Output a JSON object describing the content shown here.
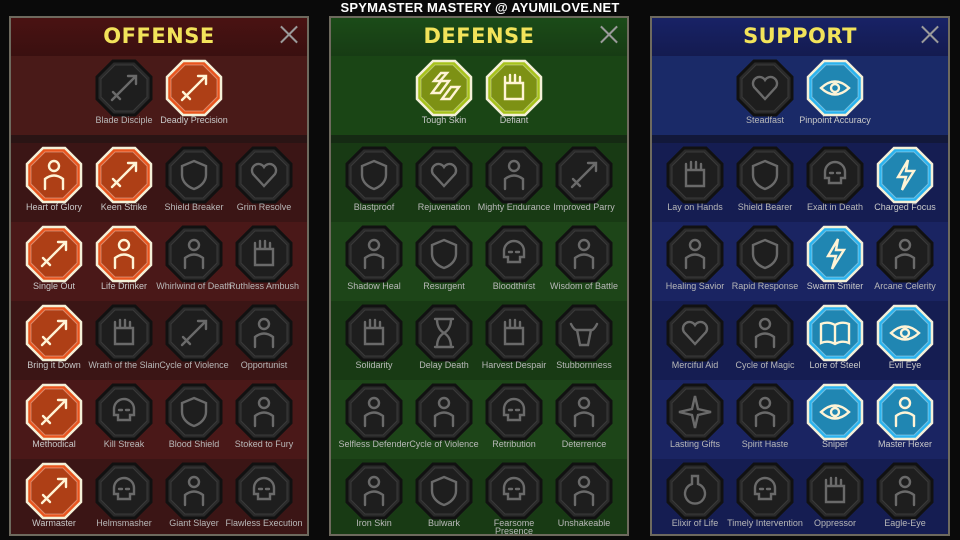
{
  "banner": "SPYMASTER MASTERY @ AYUMILOVE.NET",
  "colors": {
    "offense_active": "#e8551e",
    "defense_active": "#a7c21b",
    "support_active": "#2bb3ee",
    "inactive": "#2a2a2a",
    "title": "#f2e35a"
  },
  "panels": [
    {
      "key": "offense",
      "title": "OFFENSE",
      "rows": [
        [
          {
            "name": "Blade Disciple",
            "active": false,
            "icon": "crossed-blades-icon"
          },
          {
            "name": "Deadly Precision",
            "active": true,
            "icon": "dagger-strike-icon"
          }
        ],
        [
          {
            "name": "Heart of Glory",
            "active": true,
            "icon": "horned-warrior-icon"
          },
          {
            "name": "Keen Strike",
            "active": true,
            "icon": "slash-icon"
          },
          {
            "name": "Shield Breaker",
            "active": false,
            "icon": "broken-shield-icon"
          },
          {
            "name": "Grim Resolve",
            "active": false,
            "icon": "heart-spikes-icon"
          }
        ],
        [
          {
            "name": "Single Out",
            "active": true,
            "icon": "arrows-target-icon"
          },
          {
            "name": "Life Drinker",
            "active": true,
            "icon": "fangs-icon"
          },
          {
            "name": "Whirlwind of Death",
            "active": false,
            "icon": "whirlwind-icon"
          },
          {
            "name": "Ruthless Ambush",
            "active": false,
            "icon": "dagger-hand-icon"
          }
        ],
        [
          {
            "name": "Bring it Down",
            "active": true,
            "icon": "sword-down-icon"
          },
          {
            "name": "Wrath of the Slain",
            "active": false,
            "icon": "fist-icon"
          },
          {
            "name": "Cycle of Violence",
            "active": false,
            "icon": "axe-icon"
          },
          {
            "name": "Opportunist",
            "active": false,
            "icon": "chains-icon"
          }
        ],
        [
          {
            "name": "Methodical",
            "active": true,
            "icon": "arrows-burst-icon"
          },
          {
            "name": "Kill Streak",
            "active": false,
            "icon": "skull-icon"
          },
          {
            "name": "Blood Shield",
            "active": false,
            "icon": "shield-icon"
          },
          {
            "name": "Stoked to Fury",
            "active": false,
            "icon": "raging-figure-icon"
          }
        ],
        [
          {
            "name": "Warmaster",
            "active": true,
            "icon": "sword-sparks-icon"
          },
          {
            "name": "Helmsmasher",
            "active": false,
            "icon": "helmet-icon"
          },
          {
            "name": "Giant Slayer",
            "active": false,
            "icon": "giant-icon"
          },
          {
            "name": "Flawless Execution",
            "active": false,
            "icon": "skull-execution-icon"
          }
        ]
      ]
    },
    {
      "key": "defense",
      "title": "DEFENSE",
      "rows": [
        [
          {
            "name": "Tough Skin",
            "active": true,
            "icon": "scales-icon"
          },
          {
            "name": "Defiant",
            "active": true,
            "icon": "raised-fist-icon"
          }
        ],
        [
          {
            "name": "Blastproof",
            "active": false,
            "icon": "chevron-shield-icon"
          },
          {
            "name": "Rejuvenation",
            "active": false,
            "icon": "heart-hand-icon"
          },
          {
            "name": "Mighty Endurance",
            "active": false,
            "icon": "strongman-icon"
          },
          {
            "name": "Improved Parry",
            "active": false,
            "icon": "parry-blades-icon"
          }
        ],
        [
          {
            "name": "Shadow Heal",
            "active": false,
            "icon": "shadow-figure-icon"
          },
          {
            "name": "Resurgent",
            "active": false,
            "icon": "knight-shield-icon"
          },
          {
            "name": "Bloodthirst",
            "active": false,
            "icon": "skull-heart-icon"
          },
          {
            "name": "Wisdom of Battle",
            "active": false,
            "icon": "sage-icon"
          }
        ],
        [
          {
            "name": "Solidarity",
            "active": false,
            "icon": "raised-hands-icon"
          },
          {
            "name": "Delay Death",
            "active": false,
            "icon": "hourglass-icon"
          },
          {
            "name": "Harvest Despair",
            "active": false,
            "icon": "open-hand-icon"
          },
          {
            "name": "Stubbornness",
            "active": false,
            "icon": "bull-icon"
          }
        ],
        [
          {
            "name": "Selfless Defender",
            "active": false,
            "icon": "defender-icon"
          },
          {
            "name": "Cycle of Violence",
            "active": false,
            "icon": "drops-icon"
          },
          {
            "name": "Retribution",
            "active": false,
            "icon": "flaming-skull-icon"
          },
          {
            "name": "Deterrence",
            "active": false,
            "icon": "deflect-icon"
          }
        ],
        [
          {
            "name": "Iron Skin",
            "active": false,
            "icon": "armored-figure-icon"
          },
          {
            "name": "Bulwark",
            "active": false,
            "icon": "tower-shield-icon"
          },
          {
            "name": "Fearsome Presence",
            "active": false,
            "icon": "demon-face-icon"
          },
          {
            "name": "Unshakeable",
            "active": false,
            "icon": "flexing-figure-icon"
          }
        ]
      ]
    },
    {
      "key": "support",
      "title": "SUPPORT",
      "rows": [
        [
          {
            "name": "Steadfast",
            "active": false,
            "icon": "heart-sparkle-icon"
          },
          {
            "name": "Pinpoint Accuracy",
            "active": true,
            "icon": "bullseye-icon"
          }
        ],
        [
          {
            "name": "Lay on Hands",
            "active": false,
            "icon": "praying-hands-icon"
          },
          {
            "name": "Shield Bearer",
            "active": false,
            "icon": "radiant-shield-icon"
          },
          {
            "name": "Exalt in Death",
            "active": false,
            "icon": "skull-flame-icon"
          },
          {
            "name": "Charged Focus",
            "active": true,
            "icon": "charged-beam-icon"
          }
        ],
        [
          {
            "name": "Healing Savior",
            "active": false,
            "icon": "healer-icon"
          },
          {
            "name": "Rapid Response",
            "active": false,
            "icon": "lightning-shield-icon"
          },
          {
            "name": "Swarm Smiter",
            "active": true,
            "icon": "lightning-strike-icon"
          },
          {
            "name": "Arcane Celerity",
            "active": false,
            "icon": "twin-figures-icon"
          }
        ],
        [
          {
            "name": "Merciful Aid",
            "active": false,
            "icon": "chained-heart-icon"
          },
          {
            "name": "Cycle of Magic",
            "active": false,
            "icon": "comet-icon"
          },
          {
            "name": "Lore of Steel",
            "active": true,
            "icon": "open-book-icon"
          },
          {
            "name": "Evil Eye",
            "active": true,
            "icon": "eye-burst-icon"
          }
        ],
        [
          {
            "name": "Lasting Gifts",
            "active": false,
            "icon": "compass-star-icon"
          },
          {
            "name": "Spirit Haste",
            "active": false,
            "icon": "winged-boot-icon"
          },
          {
            "name": "Sniper",
            "active": true,
            "icon": "eye-icon"
          },
          {
            "name": "Master Hexer",
            "active": true,
            "icon": "hex-rune-icon"
          }
        ],
        [
          {
            "name": "Elixir of Life",
            "active": false,
            "icon": "potion-icon"
          },
          {
            "name": "Timely Intervention",
            "active": false,
            "icon": "skull-hood-icon"
          },
          {
            "name": "Oppressor",
            "active": false,
            "icon": "crushing-fist-icon"
          },
          {
            "name": "Eagle-Eye",
            "active": false,
            "icon": "eagle-icon"
          }
        ]
      ]
    }
  ]
}
